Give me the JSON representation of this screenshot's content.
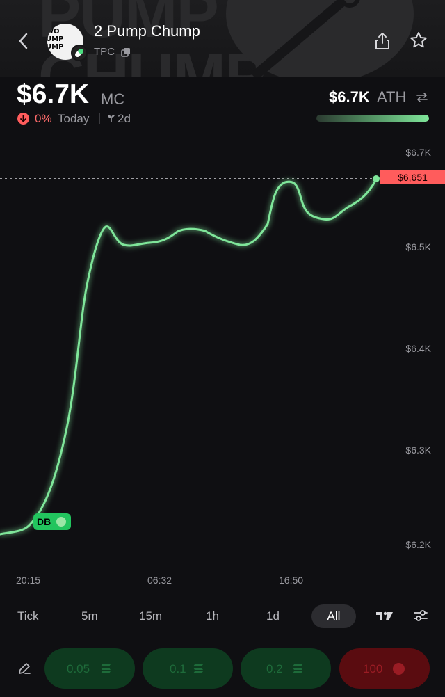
{
  "header": {
    "token_name": "2 Pump Chump",
    "ticker": "TPC",
    "banner_text_line1": "PUMP",
    "banner_text_line2": "CHUMP",
    "avatar_text": [
      "WO",
      "UMP",
      "UMP"
    ]
  },
  "stats": {
    "market_cap": "$6.7K",
    "market_cap_label": "MC",
    "change_pct": "0%",
    "change_period": "Today",
    "age": "2d",
    "ath_value": "$6.7K",
    "ath_label": "ATH",
    "ath_progress": 1.0
  },
  "chart_data": {
    "type": "line",
    "y_ticks": [
      "$6.7K",
      "$6.5K",
      "$6.4K",
      "$6.3K",
      "$6.2K"
    ],
    "x_ticks": [
      "20:15",
      "06:32",
      "16:50"
    ],
    "current_price_label": "$6,651",
    "marker_label": "DB",
    "color": "#7fe69a"
  },
  "timeframes": {
    "items": [
      "Tick",
      "5m",
      "15m",
      "1h",
      "1d"
    ],
    "active": "All"
  },
  "quick_buy": {
    "amounts": [
      "0.05",
      "0.1",
      "0.2"
    ],
    "custom": "100"
  }
}
